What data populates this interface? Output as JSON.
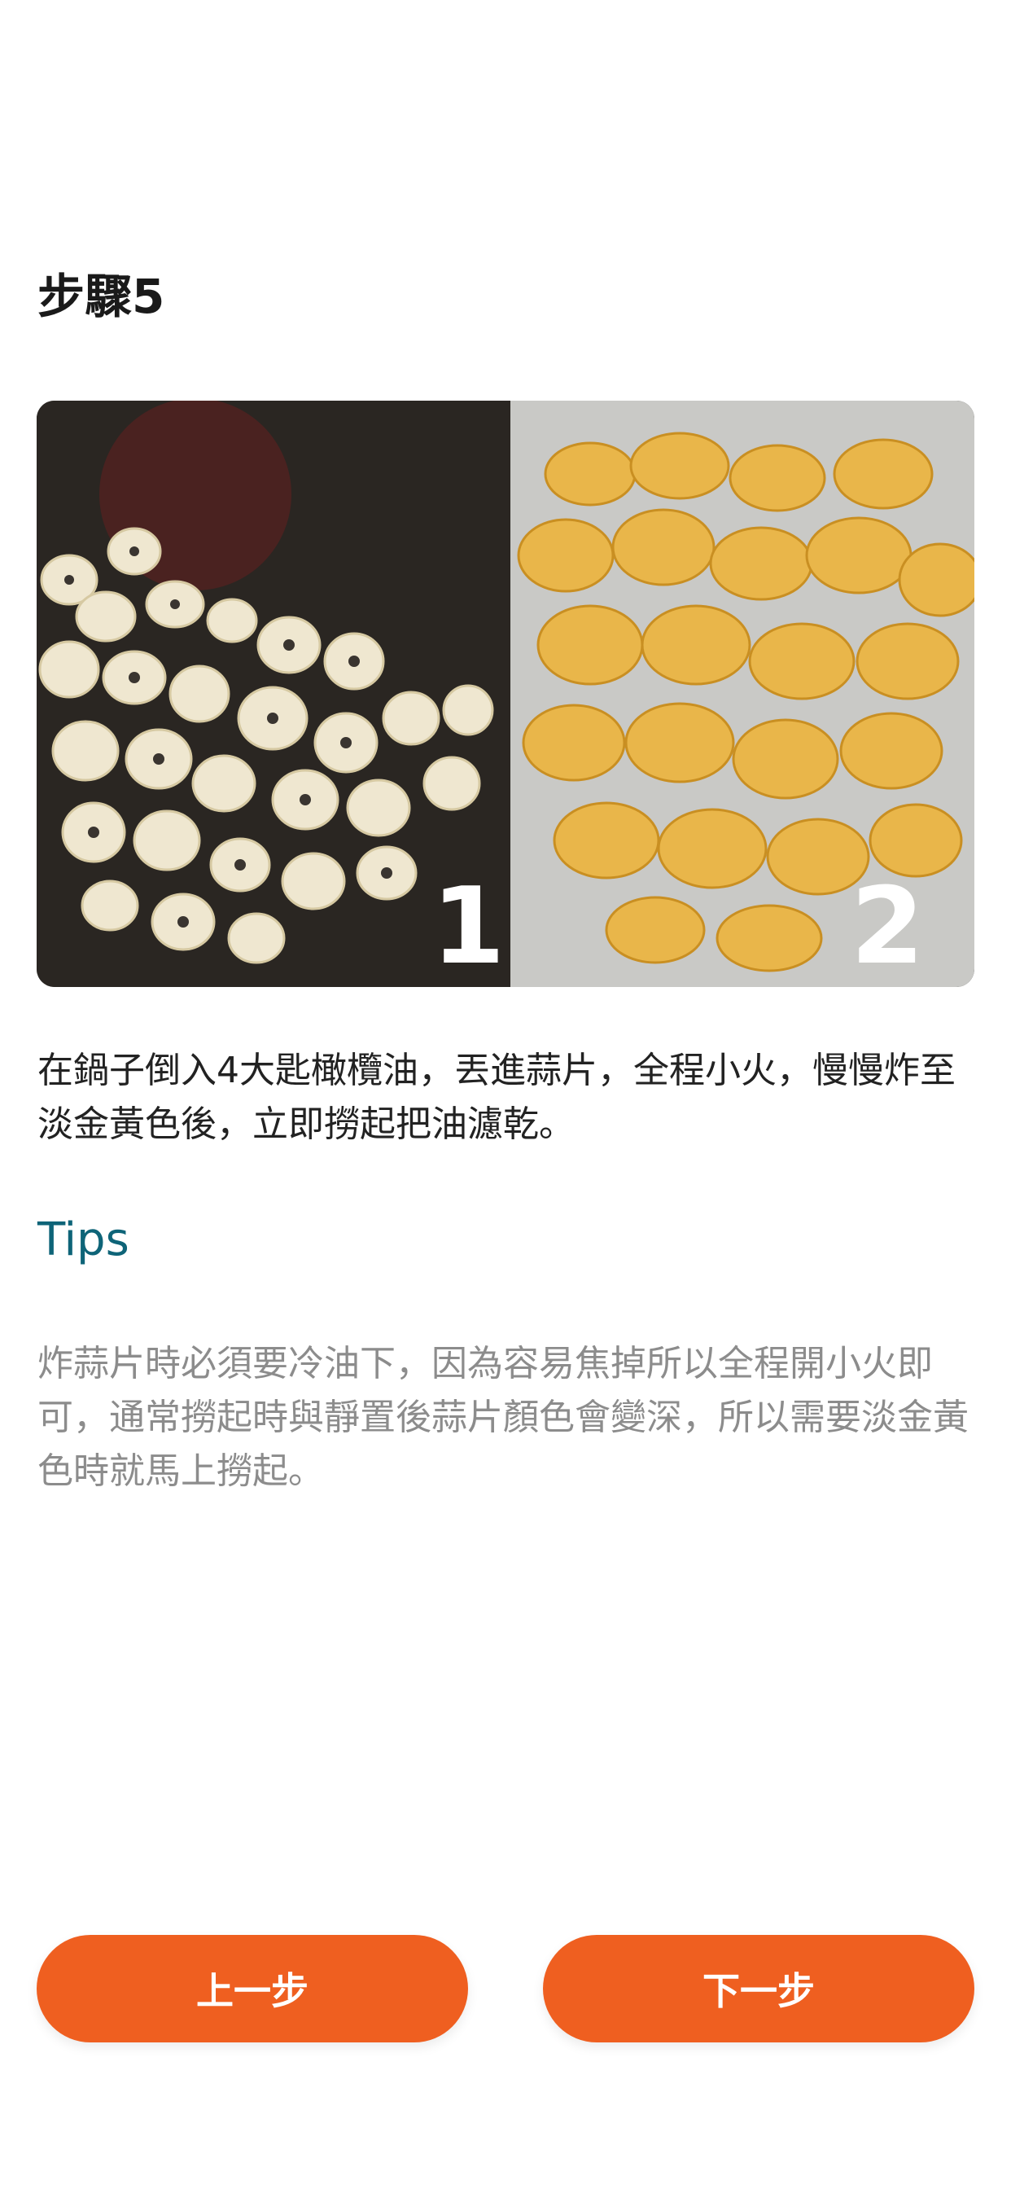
{
  "step": {
    "title": "步驟5"
  },
  "photo": {
    "panel_1_label": "1",
    "panel_2_label": "2"
  },
  "instruction": "在鍋子倒入4大匙橄欖油，丟進蒜片，全程小火，慢慢炸至淡金黃色後，立即撈起把油濾乾。",
  "tips": {
    "heading": "Tips",
    "text": "炸蒜片時必須要冷油下，因為容易焦掉所以全程開小火即可，通常撈起時與靜置後蒜片顏色會變深，所以需要淡金黃色時就馬上撈起。"
  },
  "nav": {
    "prev_label": "上一步",
    "next_label": "下一步"
  },
  "colors": {
    "accent": "#ef5f20",
    "tips_heading": "#0e6478",
    "tips_text": "#8c8c8c"
  }
}
